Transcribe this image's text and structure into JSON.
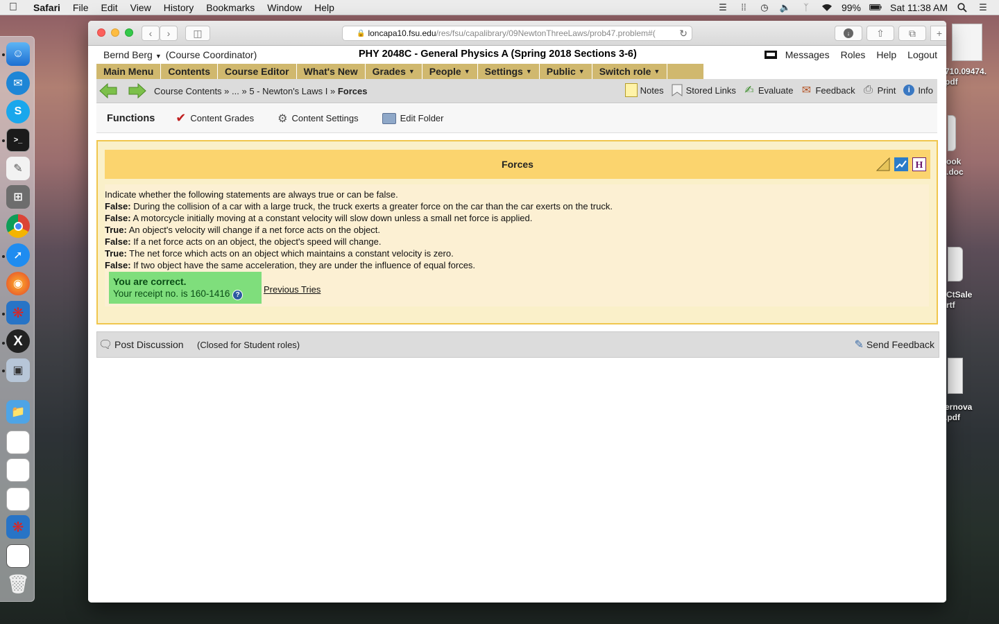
{
  "menubar": {
    "app_name": "Safari",
    "items": [
      "File",
      "Edit",
      "View",
      "History",
      "Bookmarks",
      "Window",
      "Help"
    ],
    "battery": "99%",
    "clock": "Sat 11:38 AM"
  },
  "desktop": {
    "files": [
      "710.09474.\npdf",
      "ook\n.doc",
      "CtSale\nrtf",
      "ernova\n.pdf"
    ]
  },
  "browser": {
    "url_domain": "loncapa10.fsu.edu",
    "url_path": "/res/fsu/capalibrary/09NewtonThreeLaws/prob47.problem#("
  },
  "header": {
    "user": "Bernd Berg",
    "role": "(Course Coordinator)",
    "course_title": "PHY 2048C - General Physics A (Spring 2018 Sections 3-6)",
    "links": [
      "Messages",
      "Roles",
      "Help",
      "Logout"
    ]
  },
  "main_menu": [
    {
      "label": "Main Menu",
      "dropdown": false
    },
    {
      "label": "Contents",
      "dropdown": false
    },
    {
      "label": "Course Editor",
      "dropdown": false
    },
    {
      "label": "What's New",
      "dropdown": false
    },
    {
      "label": "Grades",
      "dropdown": true
    },
    {
      "label": "People",
      "dropdown": true
    },
    {
      "label": "Settings",
      "dropdown": true
    },
    {
      "label": "Public",
      "dropdown": true
    },
    {
      "label": "Switch role",
      "dropdown": true
    }
  ],
  "breadcrumb": {
    "items": [
      "Course Contents",
      "...",
      "5 - Newton's Laws I"
    ],
    "current": "Forces"
  },
  "nav_tools": [
    "Notes",
    "Stored Links",
    "Evaluate",
    "Feedback",
    "Print",
    "Info"
  ],
  "functions": {
    "title": "Functions",
    "items": [
      "Content Grades",
      "Content Settings",
      "Edit Folder"
    ]
  },
  "problem": {
    "title": "Forces",
    "prompt": "Indicate whether the following statements are always true or can be false.",
    "statements": [
      {
        "answer": "False:",
        "text": " During the collision of a car with a large truck, the truck exerts a greater force on the car than the car exerts on the truck."
      },
      {
        "answer": "False:",
        "text": " A motorcycle initially moving at a constant velocity will slow down unless a small net force is applied."
      },
      {
        "answer": "True:",
        "text": " An object's velocity will change if a net force acts on the object."
      },
      {
        "answer": "False:",
        "text": " If a net force acts on an object, the object's speed will change."
      },
      {
        "answer": "True:",
        "text": " The net force which acts on an object which maintains a constant velocity is zero."
      },
      {
        "answer": "False:",
        "text": " If two object have the same acceleration, they are under the influence of equal forces."
      }
    ],
    "result": "You are correct.",
    "receipt": "Your receipt no. is 160-1416",
    "previous_tries": "Previous Tries"
  },
  "discussion": {
    "post": "Post Discussion",
    "closed": "(Closed for Student roles)",
    "send": "Send Feedback"
  },
  "colors": {
    "menu_gold": "#d0b86e",
    "problem_border": "#f0c64d",
    "problem_header": "#fbd46e",
    "correct_green": "#7fde7c"
  }
}
